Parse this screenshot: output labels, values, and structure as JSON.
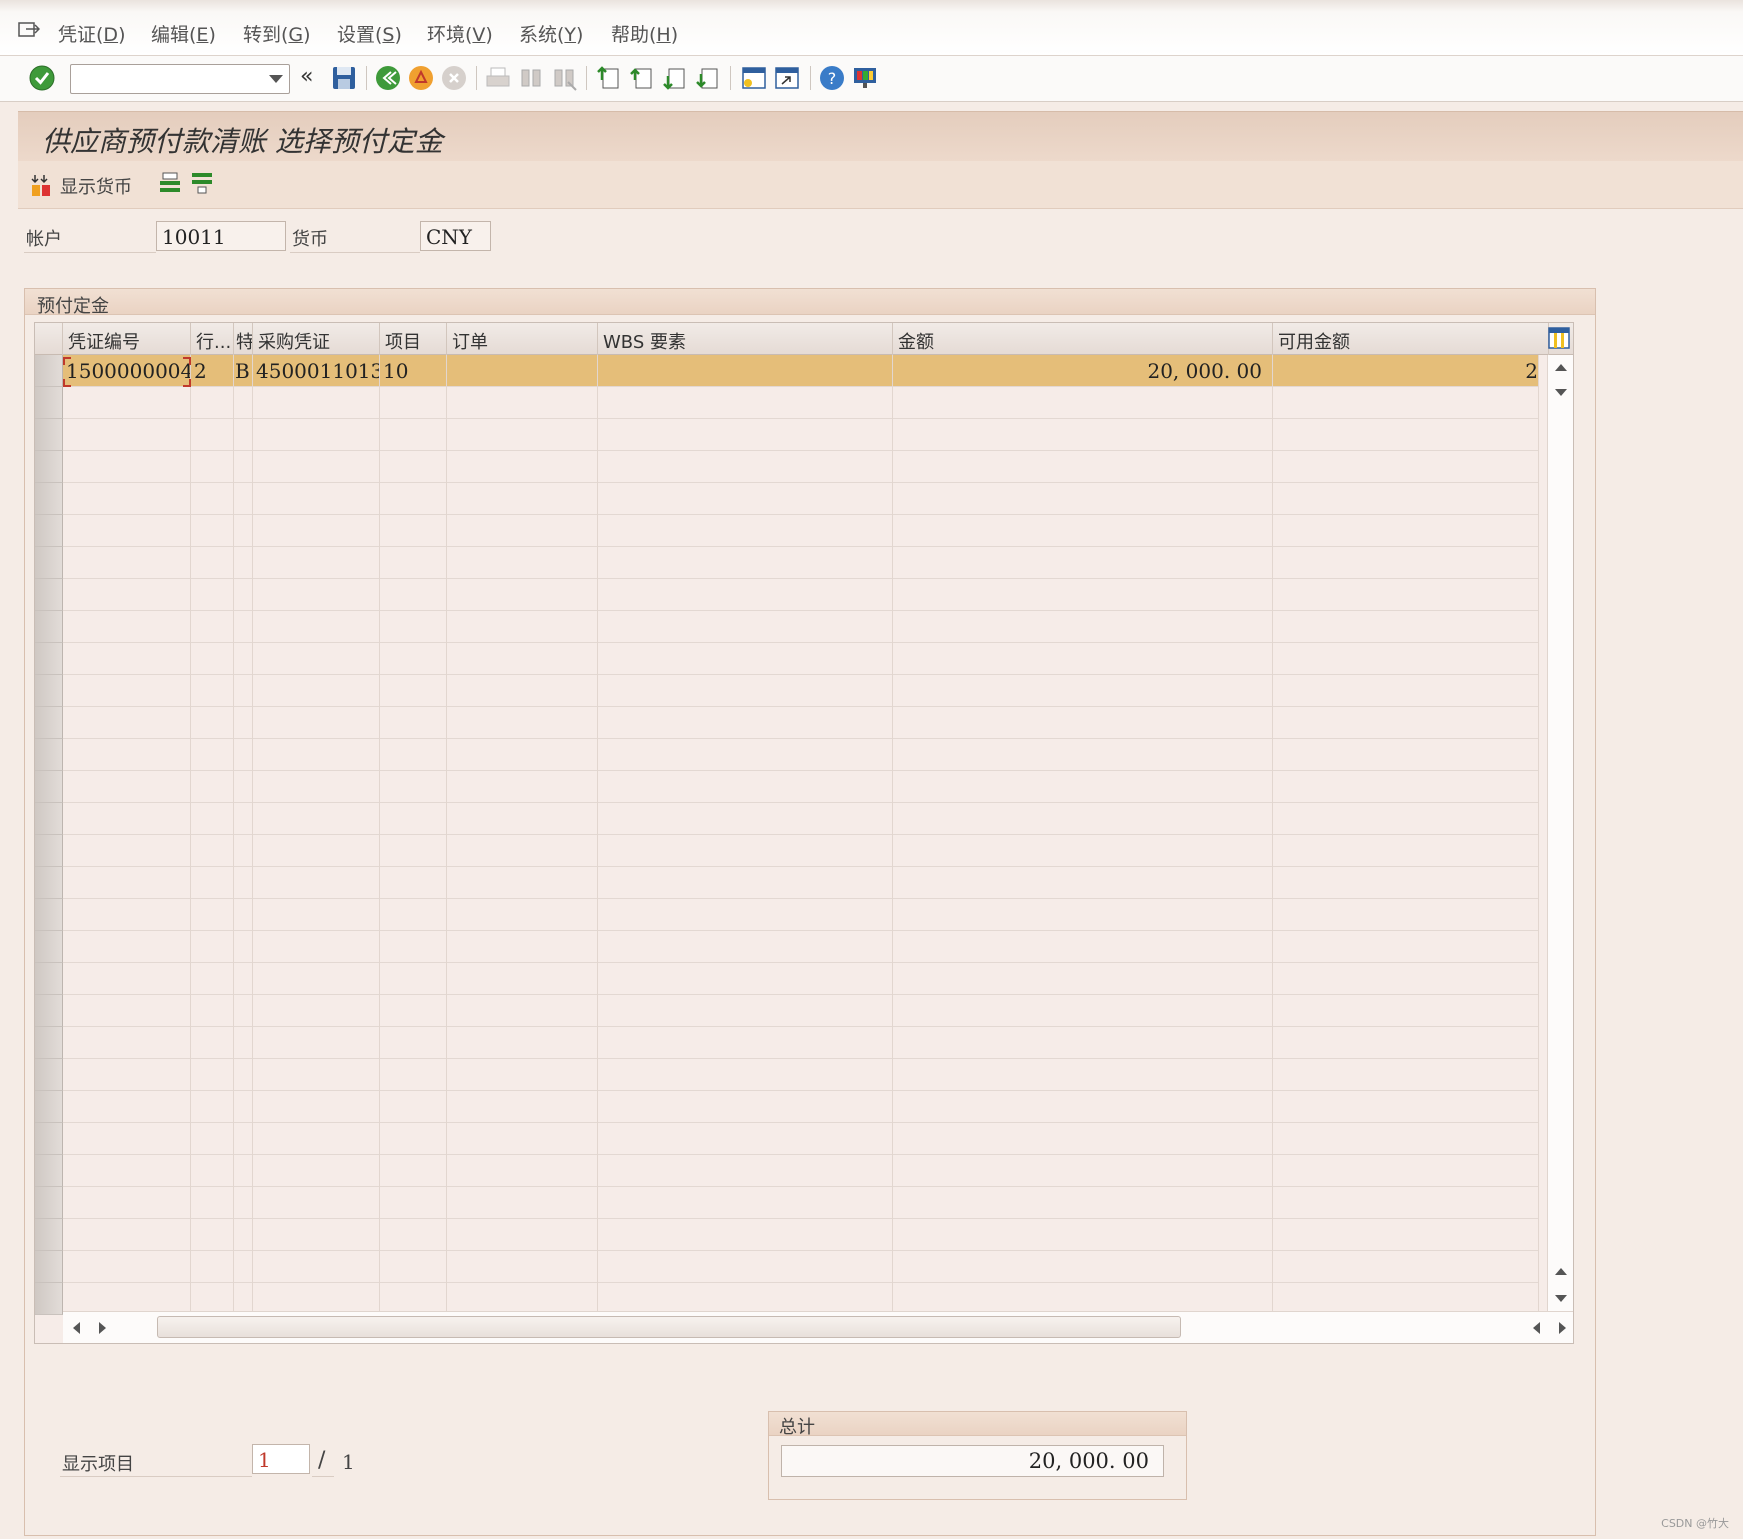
{
  "menu": {
    "items": [
      {
        "label": "凭证(",
        "key": "D",
        "close": ")"
      },
      {
        "label": "编辑(",
        "key": "E",
        "close": ")"
      },
      {
        "label": "转到(",
        "key": "G",
        "close": ")"
      },
      {
        "label": "设置(",
        "key": "S",
        "close": ")"
      },
      {
        "label": "环境(",
        "key": "V",
        "close": ")"
      },
      {
        "label": "系统(",
        "key": "Y",
        "close": ")"
      },
      {
        "label": "帮助(",
        "key": "H",
        "close": ")"
      }
    ]
  },
  "toolbar": {
    "command_field_value": "",
    "back_symbol": "«"
  },
  "screen": {
    "title": "供应商预付款清账 选择预付定金"
  },
  "apptoolbar": {
    "show_currency_label": "显示货币"
  },
  "header": {
    "account_label": "帐户",
    "account_value": "10011",
    "currency_label": "货币",
    "currency_value": "CNY"
  },
  "group": {
    "title": "预付定金"
  },
  "table": {
    "columns": [
      "凭证编号",
      "行...",
      "特",
      "采购凭证",
      "项目",
      "订单",
      "WBS 要素",
      "金额",
      "可用金额"
    ],
    "rows": [
      {
        "doc_no": "1500000004",
        "line": "2",
        "sp": "B",
        "po": "4500011013",
        "item": "10",
        "order": "",
        "wbs": "",
        "amount": "20, 000. 00",
        "available": "2"
      }
    ]
  },
  "footer": {
    "display_items_label": "显示项目",
    "current_item": "1",
    "separator": "/",
    "total_items": "1"
  },
  "totals": {
    "title": "总计",
    "value": "20, 000. 00"
  },
  "watermark": "CSDN @竹大",
  "colors": {
    "selected_row": "#e5be79",
    "title_bar": "#e4cdbd",
    "background": "#f5ece6"
  }
}
